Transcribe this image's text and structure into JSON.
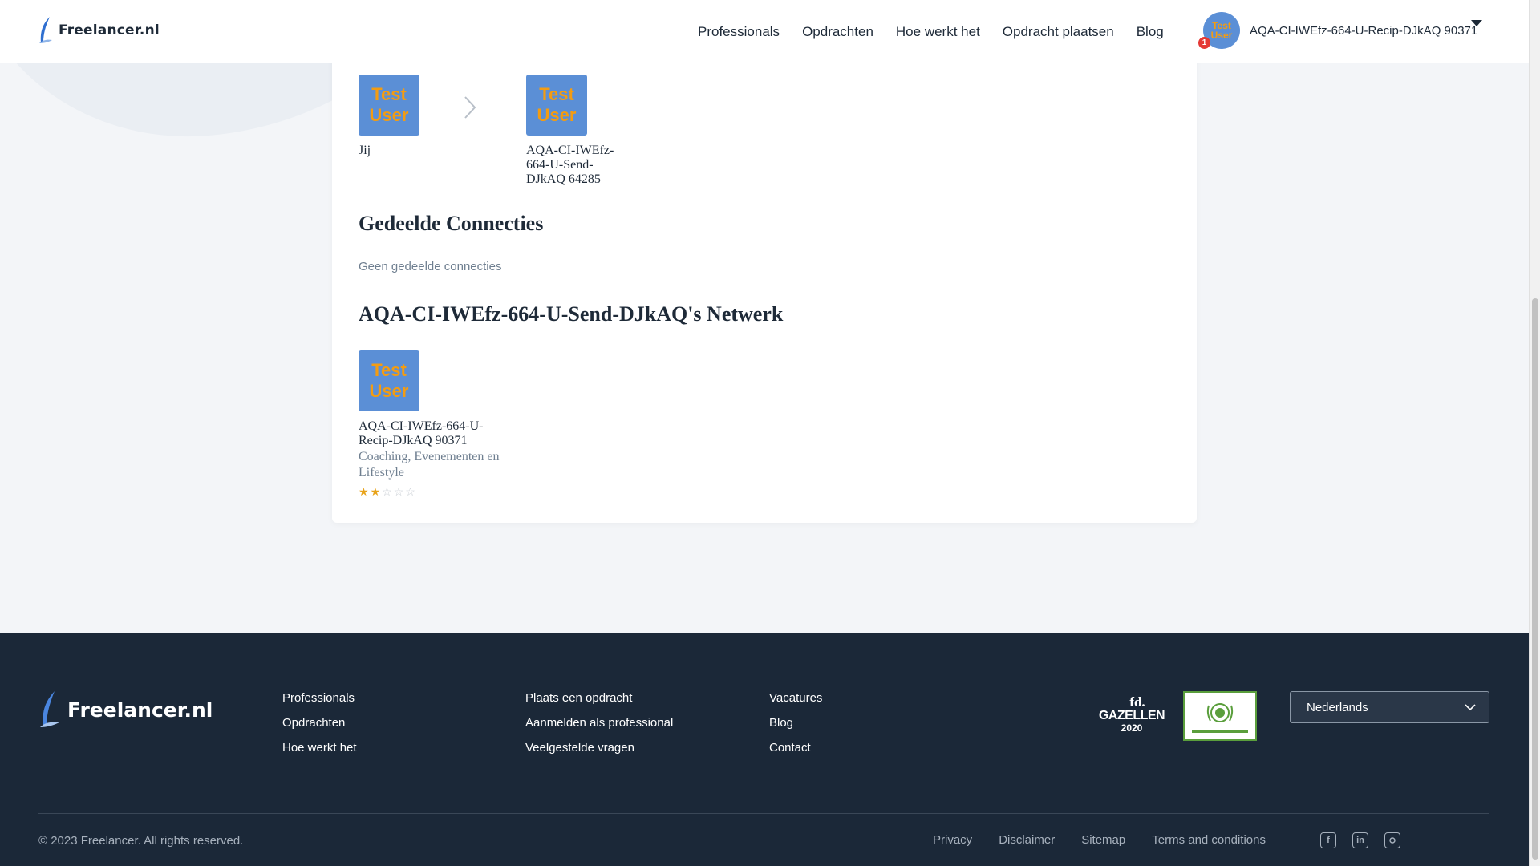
{
  "header": {
    "logo_text": "Freelancer.nl",
    "nav": [
      "Professionals",
      "Opdrachten",
      "Hoe werkt het",
      "Opdracht plaatsen",
      "Blog"
    ],
    "user_name": "AQA-CI-IWEfz-664-U-Recip-DJkAQ 90371",
    "avatar_text": [
      "Test",
      "User"
    ],
    "notification_count": "1"
  },
  "connection_path": {
    "you_label": "Jij",
    "target_name": "AQA-CI-IWEfz-664-U-Send-DJkAQ 64285",
    "avatar_text": [
      "Test",
      "User"
    ]
  },
  "shared": {
    "title": "Gedeelde Connecties",
    "empty_text": "Geen gedeelde connecties"
  },
  "network": {
    "title": "AQA-CI-IWEfz-664-U-Send-DJkAQ's Netwerk",
    "members": [
      {
        "name": "AQA-CI-IWEfz-664-U-Recip-DJkAQ 90371",
        "tags": "Coaching, Evenementen en Lifestyle",
        "rating": 2,
        "rating_max": 5
      }
    ]
  },
  "footer": {
    "logo_text": "Freelancer.nl",
    "col1": [
      "Professionals",
      "Opdrachten",
      "Hoe werkt het"
    ],
    "col2": [
      "Plaats een opdracht",
      "Aanmelden als professional",
      "Veelgestelde vragen"
    ],
    "col3": [
      "Vacatures",
      "Blog",
      "Contact"
    ],
    "fd_badge_line1": "fd.",
    "fd_badge_line2": "GAZELLEN",
    "fd_badge_line3": "2020",
    "language": "Nederlands",
    "copyright": "© 2023 Freelancer. All rights reserved.",
    "legal": [
      "Privacy",
      "Disclaimer",
      "Sitemap",
      "Terms and conditions"
    ],
    "social": [
      "facebook-icon",
      "linkedin-icon",
      "instagram-icon"
    ]
  },
  "colors": {
    "avatar_bg": "#5b8fd6",
    "avatar_text": "#f39c12",
    "footer_bg": "#1b2838",
    "star_active": "#e8a31a"
  }
}
